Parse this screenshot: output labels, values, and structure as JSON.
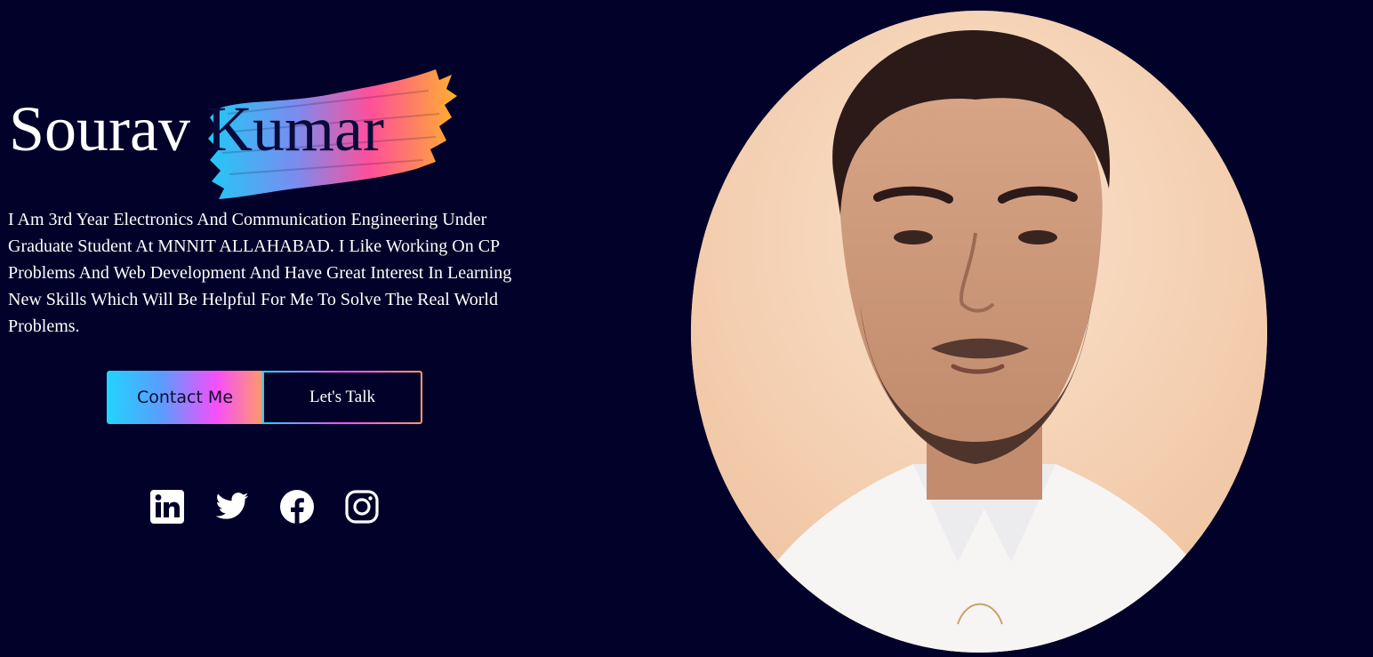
{
  "hero": {
    "first_name": "Sourav",
    "last_name": "Kumar",
    "bio": "I Am 3rd Year Electronics And Communication Engineering Under Graduate Student At MNNIT ALLAHABAD. I Like Working On CP Problems And Web Development And Have Great Interest In Learning New Skills Which Will Be Helpful For Me To Solve The Real World Problems."
  },
  "buttons": {
    "contact_label": "Contact Me",
    "talk_label": "Let's Talk"
  },
  "social": [
    {
      "icon": "linkedin-icon"
    },
    {
      "icon": "twitter-icon"
    },
    {
      "icon": "facebook-icon"
    },
    {
      "icon": "instagram-icon"
    }
  ],
  "colors": {
    "background": "#02012a",
    "gradient_start": "#21d4fd",
    "gradient_mid": "#f64ffa",
    "gradient_end": "#ff9a6a"
  }
}
